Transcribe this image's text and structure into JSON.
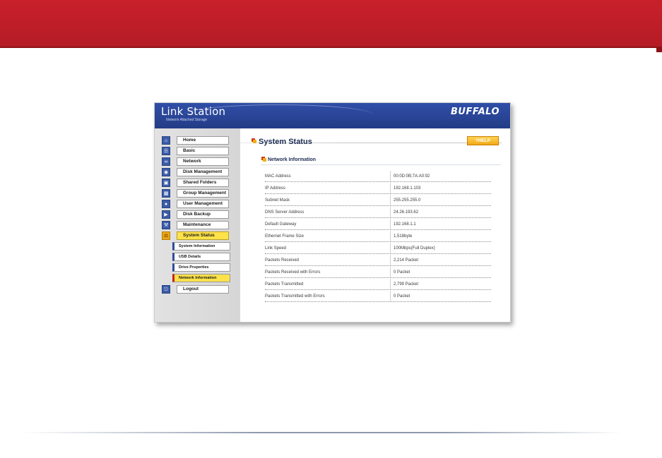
{
  "app": {
    "name": "Link Station",
    "tagline": "Network Attached Storage",
    "brand": "BUFFALO"
  },
  "sidebar": {
    "items": [
      {
        "label": "Home",
        "icon": "home-icon",
        "active": false
      },
      {
        "label": "Basic",
        "icon": "basic-settings-icon",
        "active": false
      },
      {
        "label": "Network",
        "icon": "network-icon",
        "active": false
      },
      {
        "label": "Disk Management",
        "icon": "disk-icon",
        "active": false
      },
      {
        "label": "Shared Folders",
        "icon": "folder-icon",
        "active": false
      },
      {
        "label": "Group Management",
        "icon": "group-icon",
        "active": false
      },
      {
        "label": "User Management",
        "icon": "user-icon",
        "active": false
      },
      {
        "label": "Disk Backup",
        "icon": "backup-icon",
        "active": false
      },
      {
        "label": "Maintenance",
        "icon": "tools-icon",
        "active": false
      },
      {
        "label": "System  Status",
        "icon": "status-icon",
        "active": true
      }
    ],
    "sub_items": [
      {
        "label": "System Information",
        "active": false
      },
      {
        "label": "USB Details",
        "active": false
      },
      {
        "label": "Drive Properties",
        "active": false
      },
      {
        "label": "Network Information",
        "active": true
      }
    ],
    "logout": {
      "label": "Logout",
      "icon": "logout-icon"
    }
  },
  "main": {
    "title": "System Status",
    "help_label": "?HELP",
    "section": "Network Information",
    "rows": [
      {
        "label": "MAC Address",
        "value": "00:0D:0B;7A:A0:92"
      },
      {
        "label": "IP Address",
        "value": "192.168.1.103"
      },
      {
        "label": "Subnet Mask",
        "value": "255.255.255.0"
      },
      {
        "label": "DNS Server Address",
        "value": "24.26.193.62"
      },
      {
        "label": "Default Gateway",
        "value": "192.168.1.1"
      },
      {
        "label": "Ethernet Frame Size",
        "value": "1,518byte"
      },
      {
        "label": "Link Speed",
        "value": "100Mbps(Full Duplex)"
      },
      {
        "label": "Packets Received",
        "value": "2,214 Packet"
      },
      {
        "label": "Packets Received with Errors",
        "value": "0 Packet"
      },
      {
        "label": "Packets Transmitted",
        "value": "2,799 Packet"
      },
      {
        "label": "Packets Transmitted with Errors",
        "value": "0 Packet"
      }
    ]
  },
  "colors": {
    "banner": "#c8202b",
    "header_blue": "#2a4596",
    "active_yellow": "#fde24a",
    "help_orange": "#f2a81b"
  }
}
